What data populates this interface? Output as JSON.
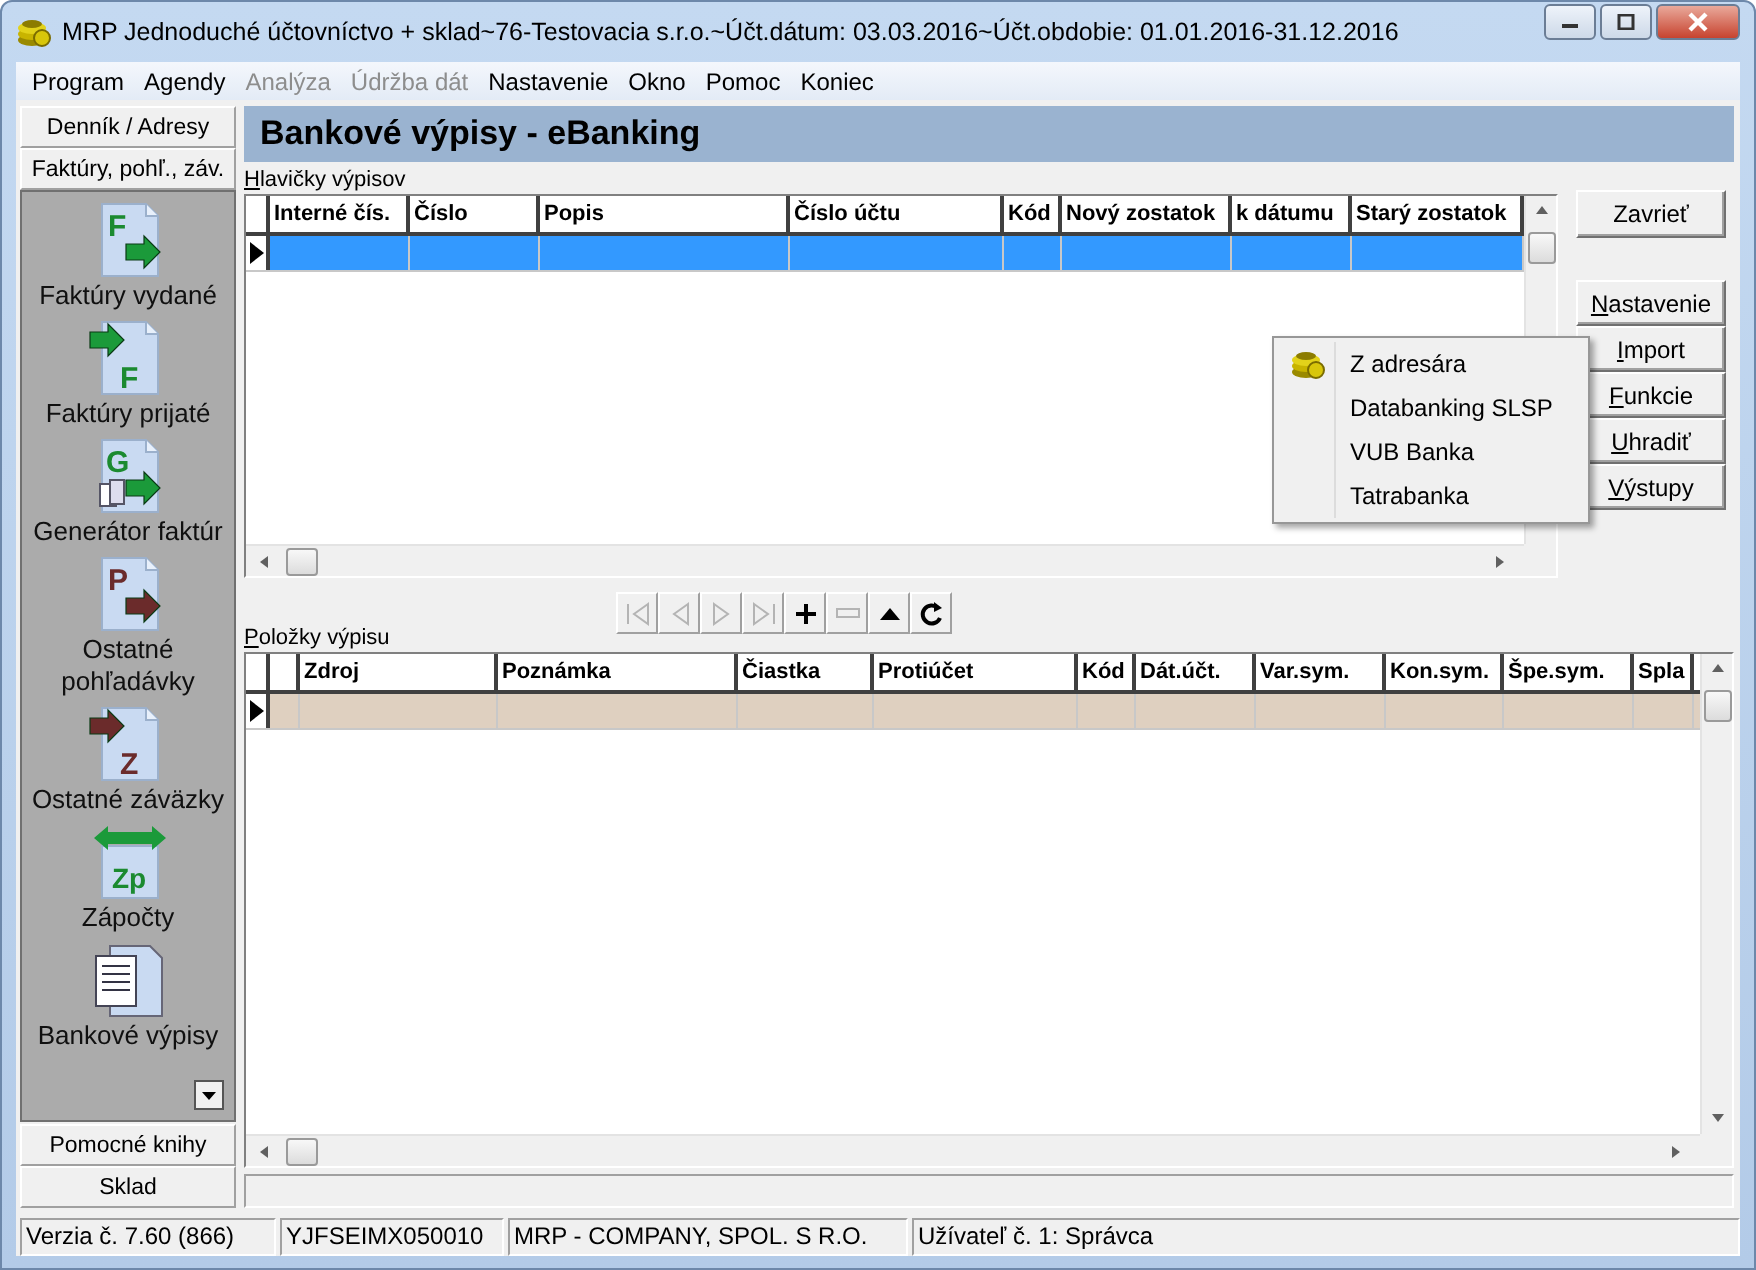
{
  "window": {
    "title": "MRP Jednoduché účtovníctvo + sklad~76-Testovacia s.r.o.~Účt.dátum: 03.03.2016~Účt.obdobie: 01.01.2016-31.12.2016"
  },
  "menu": [
    {
      "label": "Program",
      "disabled": false
    },
    {
      "label": "Agendy",
      "disabled": false
    },
    {
      "label": "Analýza",
      "disabled": true
    },
    {
      "label": "Údržba dát",
      "disabled": true
    },
    {
      "label": "Nastavenie",
      "disabled": false
    },
    {
      "label": "Okno",
      "disabled": false
    },
    {
      "label": "Pomoc",
      "disabled": false
    },
    {
      "label": "Koniec",
      "disabled": false
    }
  ],
  "sidebar": {
    "top_sections": [
      "Denník / Adresy",
      "Faktúry, pohľ., záv."
    ],
    "items": [
      {
        "label": "Faktúry vydané",
        "kind": "out",
        "icon_letter": "F"
      },
      {
        "label": "Faktúry prijaté",
        "kind": "in",
        "icon_letter": "F"
      },
      {
        "label": "Generátor faktúr",
        "kind": "generator",
        "icon_letter": "G"
      },
      {
        "label": "Ostatné pohľadávky",
        "kind": "out-dark",
        "icon_letter": "P"
      },
      {
        "label": "Ostatné záväzky",
        "kind": "in-dark",
        "icon_letter": "Z"
      },
      {
        "label": "Zápočty",
        "kind": "offset",
        "icon_letter": "Zp"
      },
      {
        "label": "Bankové výpisy",
        "kind": "statement"
      }
    ],
    "bottom_sections": [
      "Pomocné knihy",
      "Sklad"
    ]
  },
  "page": {
    "title": "Bankové výpisy - eBanking"
  },
  "headers_grid": {
    "label": "Hlavičky výpisov",
    "columns": [
      "Interné čís.",
      "Číslo",
      "Popis",
      "Číslo účtu",
      "Kód",
      "Nový zostatok",
      "k dátumu",
      "Starý zostatok"
    ],
    "rows": [
      {
        "selected": true
      }
    ]
  },
  "buttons": [
    {
      "label": "Zavrieť",
      "hotkey": false
    },
    {
      "label": "Nastavenie",
      "hotkey": true
    },
    {
      "label": "Import",
      "hotkey": true
    },
    {
      "label": "Funkcie",
      "hotkey": true
    },
    {
      "label": "Uhradiť",
      "hotkey": true
    },
    {
      "label": "Výstupy",
      "hotkey": true
    }
  ],
  "context_menu": {
    "items": [
      {
        "label": "Z adresára",
        "has_icon": true
      },
      {
        "label": "Databanking SLSP",
        "has_icon": false
      },
      {
        "label": "VUB Banka",
        "has_icon": false
      },
      {
        "label": "Tatrabanka",
        "has_icon": false
      }
    ]
  },
  "navigator": [
    {
      "kind": "first",
      "disabled": true
    },
    {
      "kind": "prev",
      "disabled": true
    },
    {
      "kind": "next",
      "disabled": true
    },
    {
      "kind": "last",
      "disabled": true
    },
    {
      "kind": "add",
      "disabled": false
    },
    {
      "kind": "remove",
      "disabled": true
    },
    {
      "kind": "up",
      "disabled": false
    },
    {
      "kind": "refresh",
      "disabled": false
    }
  ],
  "items_grid": {
    "label": "Položky výpisu",
    "columns": [
      "",
      "Zdroj",
      "Poznámka",
      "Čiastka",
      "Protiúčet",
      "Kód",
      "Dát.účt.",
      "Var.sym.",
      "Kon.sym.",
      "Špe.sym.",
      "Spla"
    ],
    "rows": [
      {
        "selected": true
      }
    ]
  },
  "status_bar": [
    "Verzia č. 7.60 (866)",
    "YJFSEIMX050010",
    "MRP - COMPANY, SPOL. S R.O.",
    "Užívateľ č. 1: Správca"
  ]
}
